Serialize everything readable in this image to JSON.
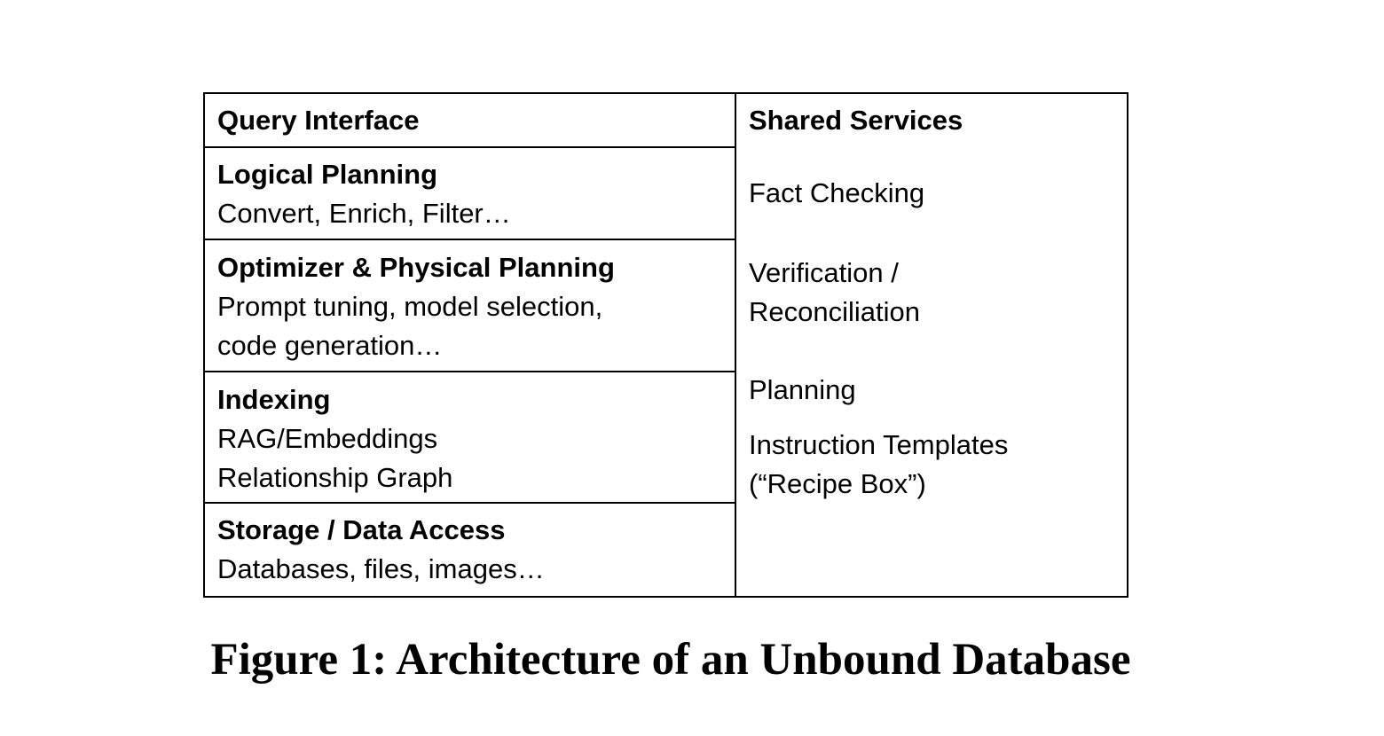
{
  "layers": [
    {
      "title": "Query Interface",
      "lines": []
    },
    {
      "title": "Logical Planning",
      "lines": [
        "Convert, Enrich, Filter…"
      ]
    },
    {
      "title": "Optimizer & Physical Planning",
      "lines": [
        "Prompt tuning, model selection,",
        "code generation…"
      ]
    },
    {
      "title": "Indexing",
      "lines": [
        "RAG/Embeddings",
        "Relationship Graph"
      ]
    },
    {
      "title": "Storage / Data Access",
      "lines": [
        "Databases, files, images…"
      ]
    }
  ],
  "shared_services": {
    "title": "Shared Services",
    "items": [
      {
        "lines": [
          "Fact Checking"
        ]
      },
      {
        "lines": [
          "Verification /",
          "Reconciliation"
        ]
      },
      {
        "lines": [
          "Planning"
        ]
      },
      {
        "lines": [
          "Instruction Templates",
          "(“Recipe Box”)"
        ]
      }
    ]
  },
  "caption": "Figure 1: Architecture of an Unbound Database"
}
